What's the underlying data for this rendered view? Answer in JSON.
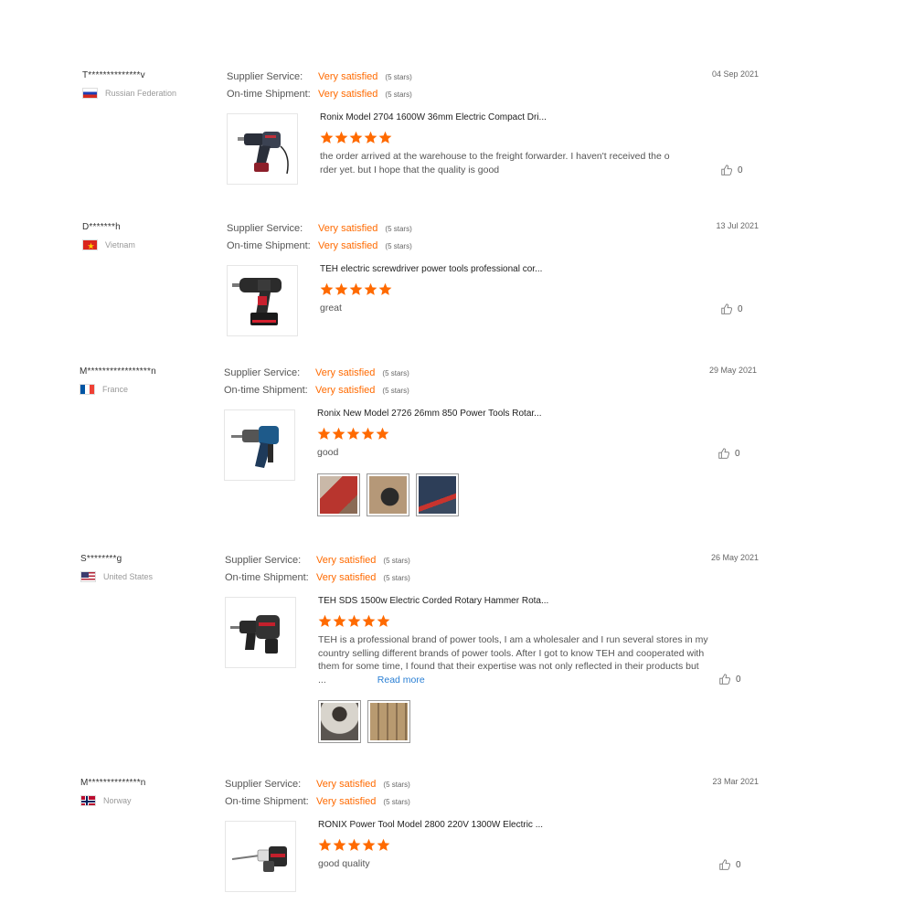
{
  "labels": {
    "supplier_service": "Supplier Service:",
    "on_time_shipment": "On-time Shipment:"
  },
  "accent_color": "#ff6a00",
  "reviews": [
    {
      "buyer": "T**************v",
      "country": "Russian Federation",
      "flag": "russia-flag",
      "date": "04 Sep 2021",
      "supplier_service": "Very satisfied",
      "supplier_stars": "(5 stars)",
      "shipment": "Very satisfied",
      "shipment_stars": "(5 stars)",
      "product_title": "Ronix Model 2704 1600W 36mm Electric Compact Dri...",
      "rating": 5,
      "text": "the order arrived at the warehouse to the freight forwarder. I haven't received the o rder yet. but I hope that the quality is good",
      "likes": "0"
    },
    {
      "buyer": "D*******h",
      "country": "Vietnam",
      "flag": "vietnam-flag",
      "date": "13 Jul 2021",
      "supplier_service": "Very satisfied",
      "supplier_stars": "(5 stars)",
      "shipment": "Very satisfied",
      "shipment_stars": "(5 stars)",
      "product_title": "TEH electric screwdriver power tools professional cor...",
      "rating": 5,
      "text": "great",
      "likes": "0"
    },
    {
      "buyer": "M*****************n",
      "country": "France",
      "flag": "france-flag",
      "date": "29 May 2021",
      "supplier_service": "Very satisfied",
      "supplier_stars": "(5 stars)",
      "shipment": "Very satisfied",
      "shipment_stars": "(5 stars)",
      "product_title": "Ronix New Model 2726 26mm 850 Power Tools Rotar...",
      "rating": 5,
      "text": "good",
      "likes": "0"
    },
    {
      "buyer": "S********g",
      "country": "United States",
      "flag": "usa-flag",
      "date": "26 May 2021",
      "supplier_service": "Very satisfied",
      "supplier_stars": "(5 stars)",
      "shipment": "Very satisfied",
      "shipment_stars": "(5 stars)",
      "product_title": "TEH SDS 1500w Electric Corded Rotary Hammer Rota...",
      "rating": 5,
      "text": "TEH is a professional brand of power tools, I am a wholesaler and I run several stores in my country selling different brands of power tools. After I got to know TEH and cooperated with them for some time, I found that their expertise was not only reflected in their products but",
      "ellipsis": "...",
      "read_more": "Read more",
      "likes": "0"
    },
    {
      "buyer": "M**************n",
      "country": "Norway",
      "flag": "norway-flag",
      "date": "23 Mar 2021",
      "supplier_service": "Very satisfied",
      "supplier_stars": "(5 stars)",
      "shipment": "Very satisfied",
      "shipment_stars": "(5 stars)",
      "product_title": "RONIX Power Tool Model 2800 220V 1300W Electric ...",
      "rating": 5,
      "text": "good quality",
      "likes": "0"
    }
  ]
}
